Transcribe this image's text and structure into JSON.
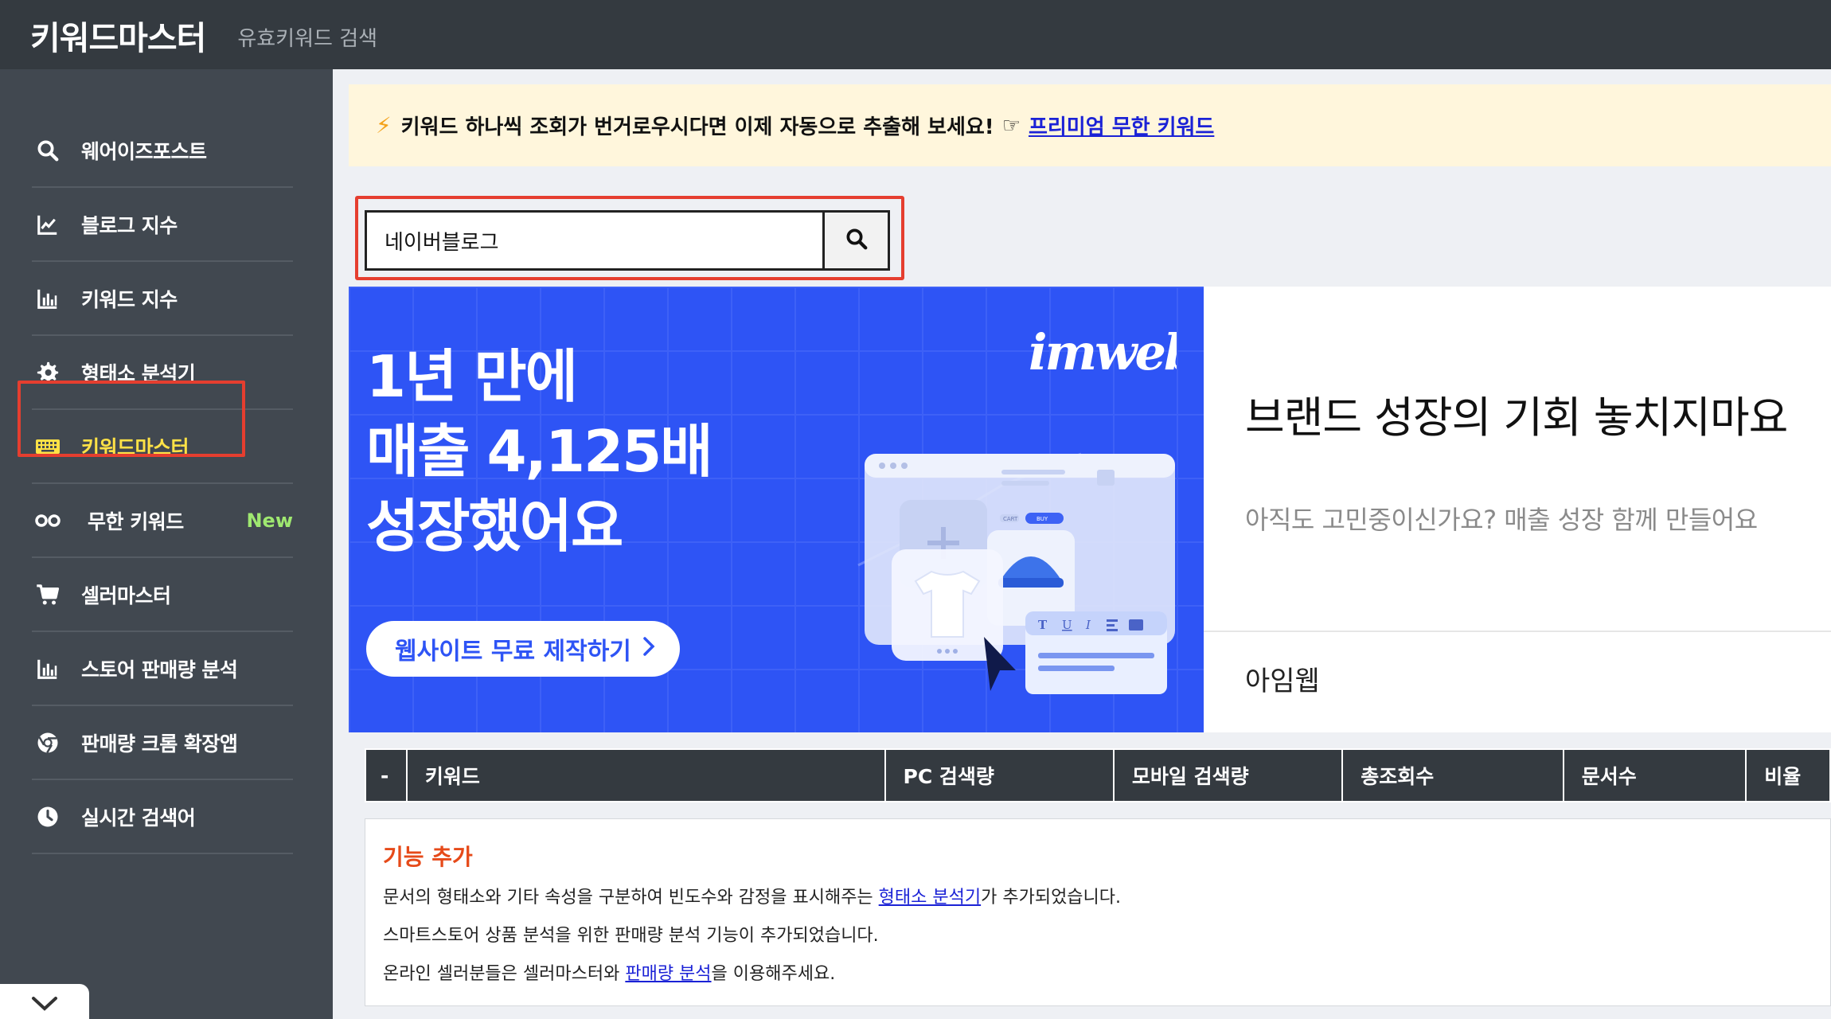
{
  "header": {
    "brand": "키워드마스터",
    "subtitle": "유효키워드 검색"
  },
  "sidebar": {
    "items": [
      {
        "label": "웨어이즈포스트",
        "icon": "search-icon"
      },
      {
        "label": "블로그 지수",
        "icon": "line-chart-icon"
      },
      {
        "label": "키워드 지수",
        "icon": "bar-chart-icon"
      },
      {
        "label": "형태소 분석기",
        "icon": "gear-icon"
      },
      {
        "label": "키워드마스터",
        "icon": "keyboard-icon",
        "active": true
      },
      {
        "label": "무한 키워드",
        "icon": "infinity-icon",
        "badge": "New"
      },
      {
        "label": "셀러마스터",
        "icon": "cart-icon"
      },
      {
        "label": "스토어 판매량 분석",
        "icon": "bar-chart-icon"
      },
      {
        "label": "판매량 크롬 확장앱",
        "icon": "chrome-icon"
      },
      {
        "label": "실시간 검색어",
        "icon": "clock-icon"
      }
    ],
    "active_color": "#ffe246",
    "badge_color": "#9fe870"
  },
  "notice": {
    "text": "키워드 하나씩 조회가 번거로우시다면 이제 자동으로 추출해 보세요!",
    "pointer": "☞",
    "link": "프리미엄 무한 키워드"
  },
  "search": {
    "value": "네이버블로그"
  },
  "ad": {
    "headline": [
      "1년 만에",
      "매출 4,125배",
      "성장했어요"
    ],
    "logo": "imweb",
    "cta": "웹사이트 무료 제작하기",
    "title": "브랜드 성장의 기회 놓치지마요",
    "description": "아직도 고민중이신가요? 매출 성장 함께 만들어요",
    "brand": "아임웹",
    "bg_color": "#2e54f5",
    "mockup": {
      "cart": "CART",
      "buy": "BUY",
      "tools": [
        "T",
        "U",
        "I"
      ]
    }
  },
  "table": {
    "headers": [
      "-",
      "키워드",
      "PC 검색량",
      "모바일 검색량",
      "총조회수",
      "문서수",
      "비율"
    ]
  },
  "info": {
    "title": "기능 추가",
    "lines": [
      {
        "before": "문서의 형태소와 기타 속성을 구분하여 빈도수와 감정을 표시해주는 ",
        "link": "형태소 분석기",
        "after": "가 추가되었습니다."
      },
      {
        "before": "스마트스토어 상품 분석을 위한 판매량 분석 기능이 추가되었습니다.",
        "link": "",
        "after": ""
      },
      {
        "before": "온라인 셀러분들은 셀러마스터와 ",
        "link": "판매량 분석",
        "after": "을 이용해주세요."
      }
    ]
  },
  "accent_red": "#e53e2f"
}
